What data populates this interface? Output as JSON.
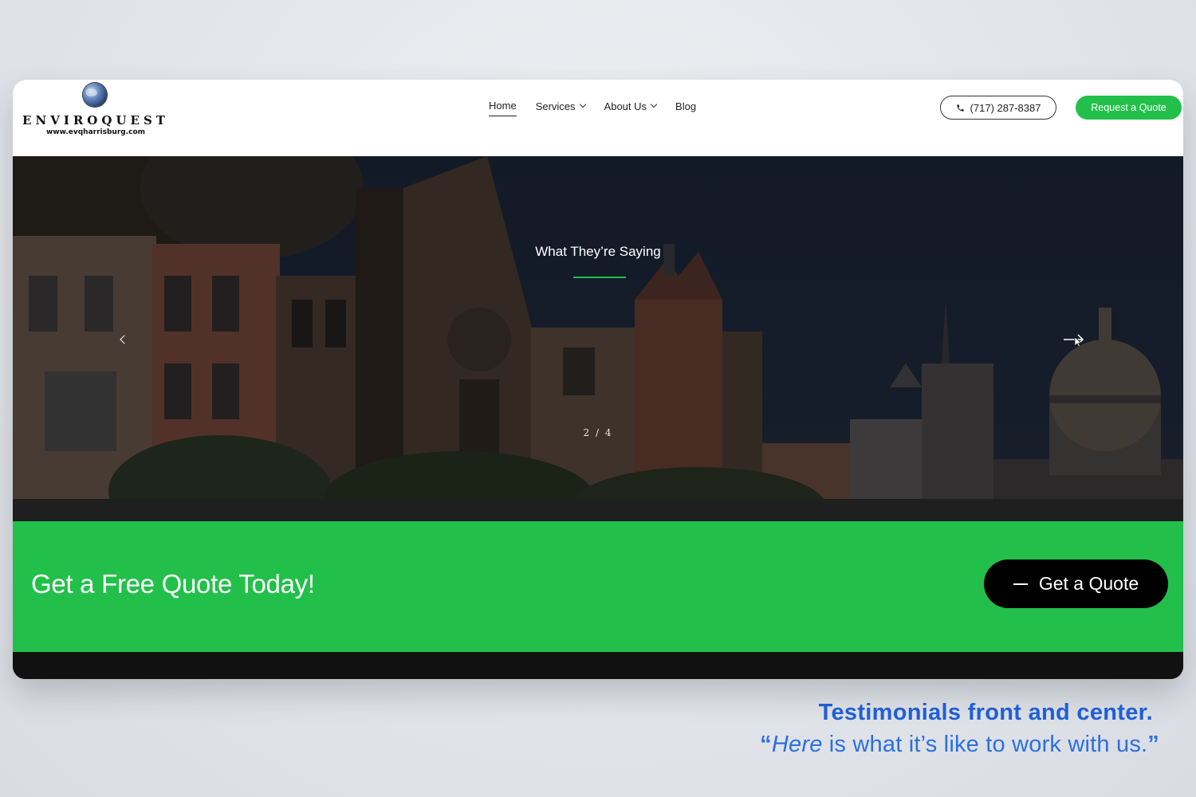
{
  "header": {
    "logo": {
      "name": "ENVIROQUEST",
      "url": "www.evqharrisburg.com",
      "icon": "globe-icon"
    },
    "nav": [
      {
        "label": "Home",
        "active": true,
        "dropdown": false
      },
      {
        "label": "Services",
        "active": false,
        "dropdown": true
      },
      {
        "label": "About Us",
        "active": false,
        "dropdown": true
      },
      {
        "label": "Blog",
        "active": false,
        "dropdown": false
      }
    ],
    "phone": {
      "label": "(717) 287-8387",
      "icon": "phone-icon"
    },
    "request_quote_label": "Request a Quote"
  },
  "hero": {
    "title": "What They’re Saying",
    "pager": "2 / 4",
    "accent_color": "#22c04a"
  },
  "cta": {
    "text": "Get a Free Quote Today!",
    "button_label": "Get a Quote",
    "background_color": "#22c04a"
  },
  "caption": {
    "line1": "Testimonials front and center.",
    "line2_open_quote": "“",
    "line2_emphasis": "Here",
    "line2_rest": " is what it’s like to work with us.",
    "line2_close_quote": "”",
    "color": "#1f5fd6"
  }
}
